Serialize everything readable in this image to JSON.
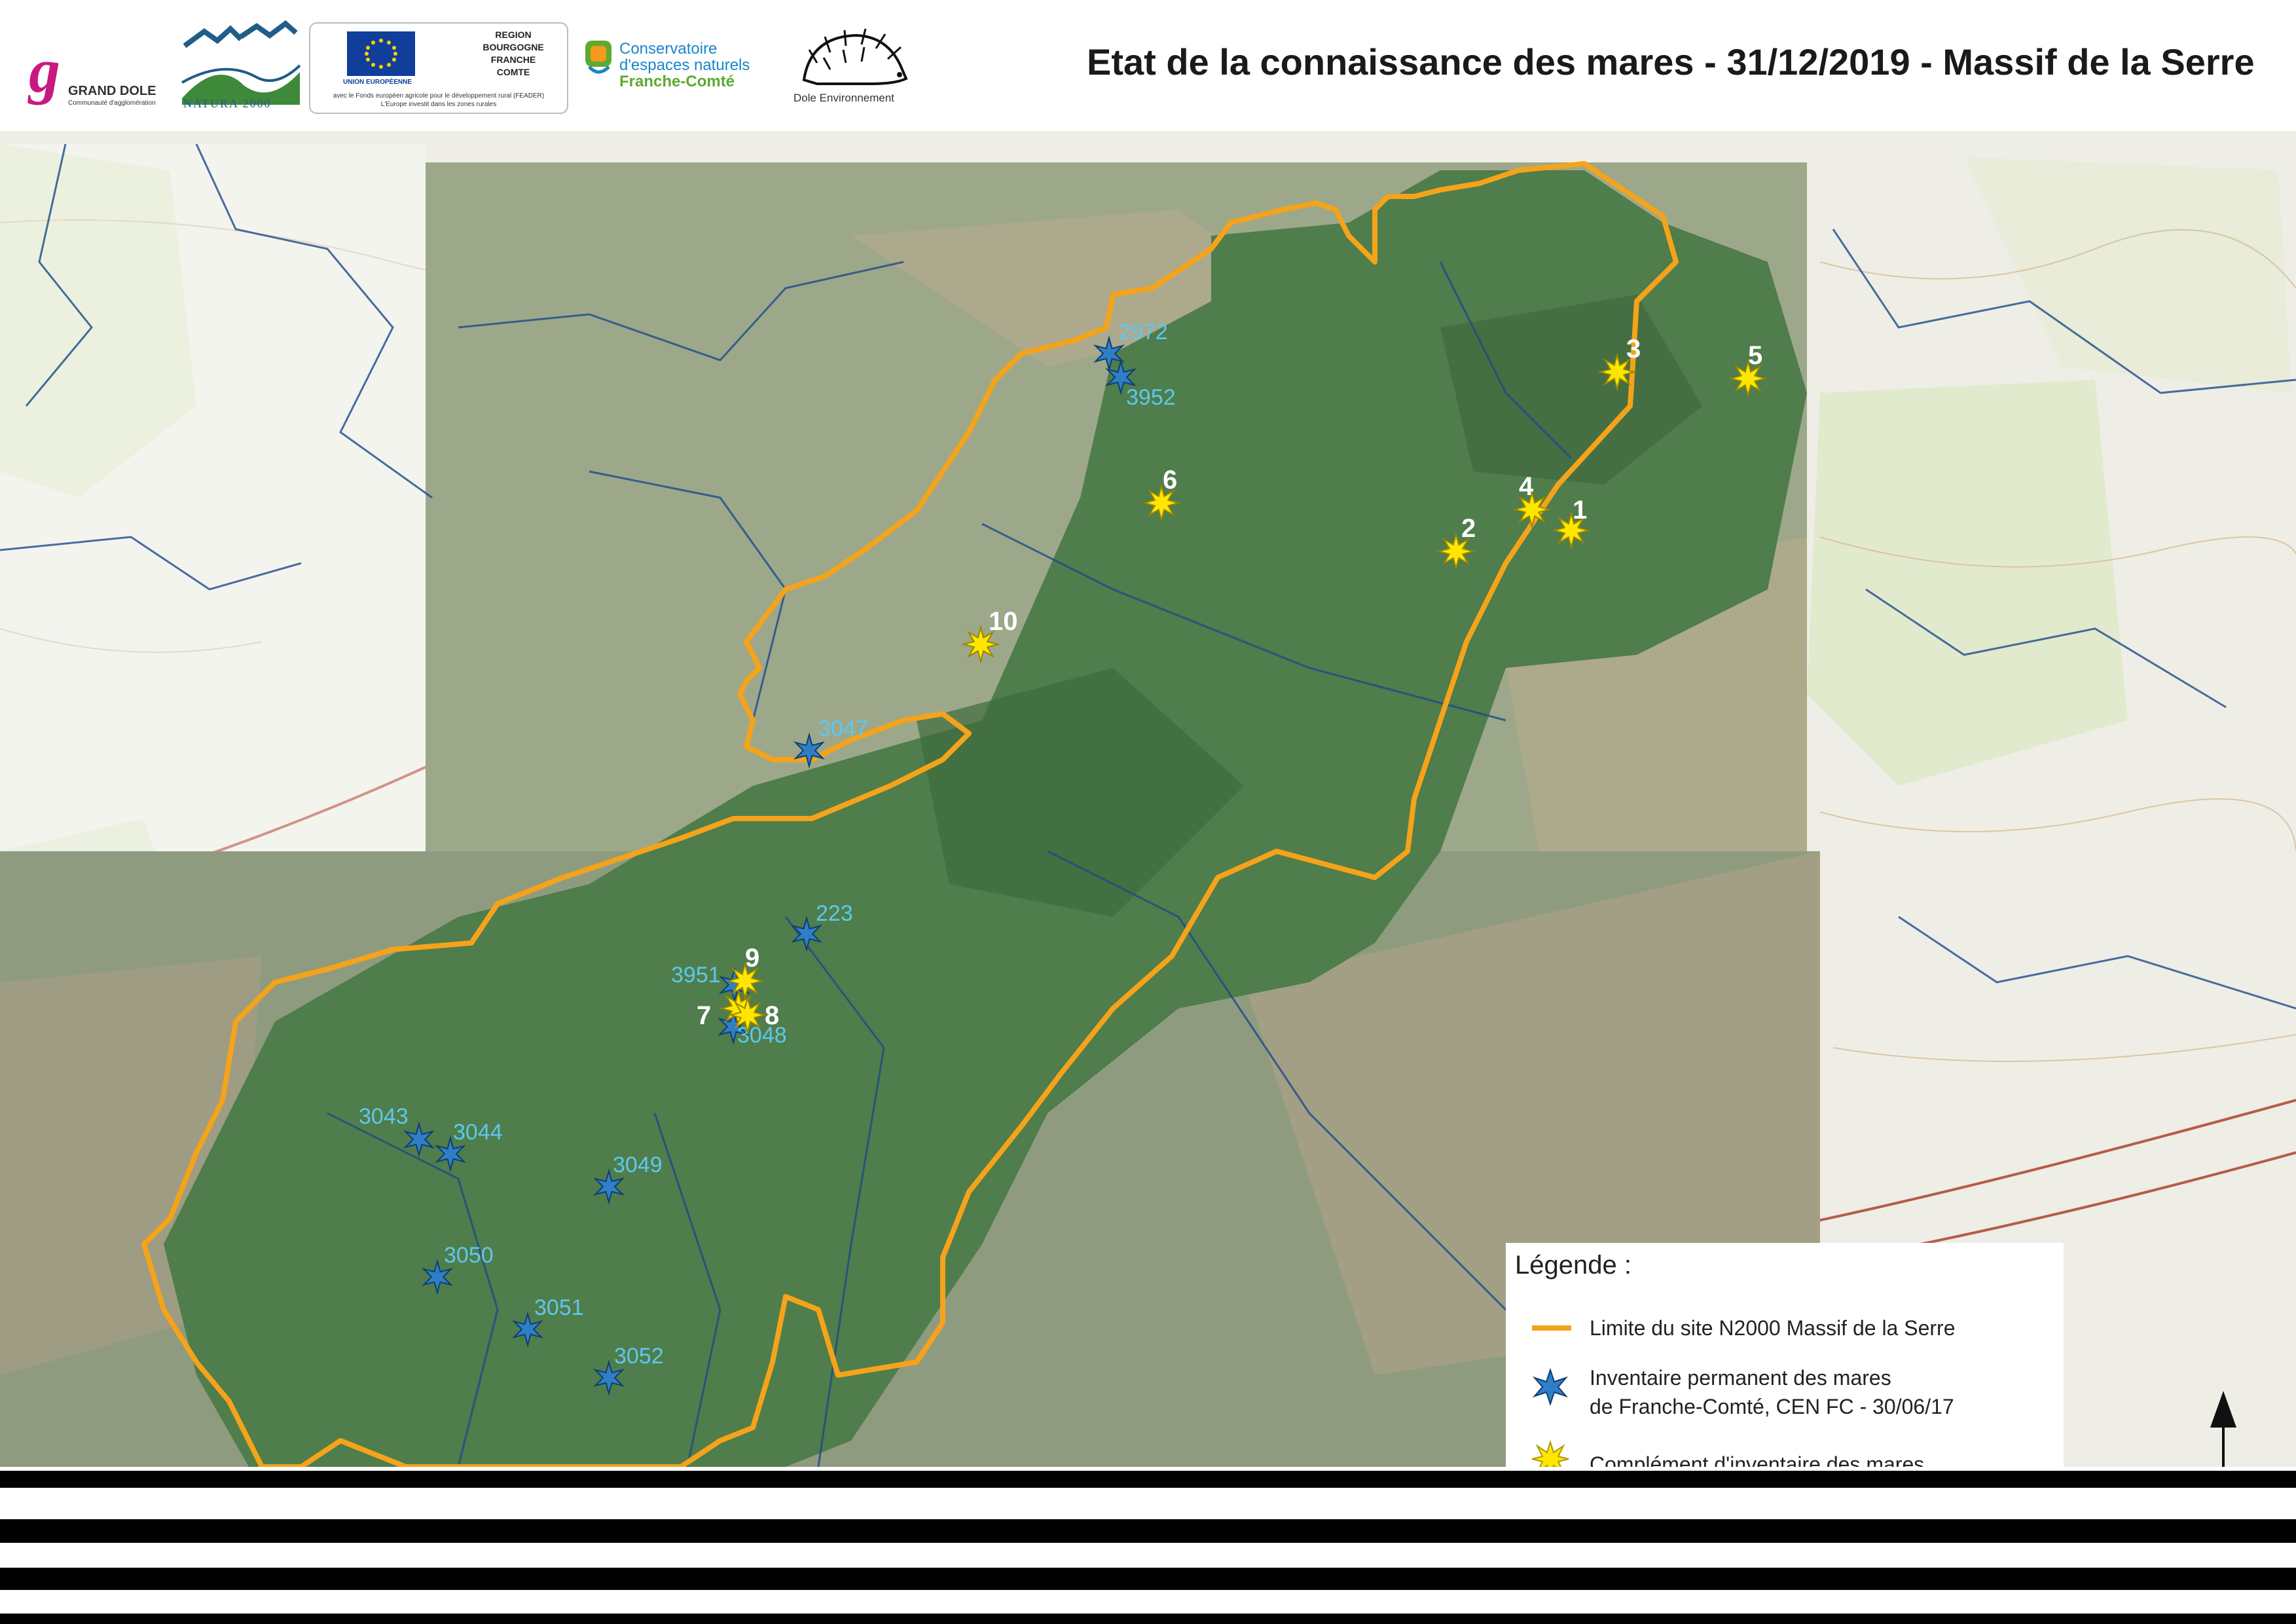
{
  "header": {
    "title": "Etat de la connaissance des mares - 31/12/2019 - Massif de la Serre",
    "logos": {
      "grand_dole_mark": "g",
      "grand_dole_name": "GRAND DOLE",
      "grand_dole_sub": "Communauté d'agglomération",
      "natura": "NATURA 2000",
      "eu_union": "UNION EUROPÉENNE",
      "region_line1": "REGION",
      "region_line2": "BOURGOGNE",
      "region_line3": "FRANCHE",
      "region_line4": "COMTE",
      "feader_line1": "avec le Fonds européen agricole pour le développement rural (FEADER)",
      "feader_line2": "L'Europe investit dans les zones rurales",
      "cen_line1": "Conservatoire",
      "cen_line2": "d'espaces naturels",
      "cen_line3": "Franche-Comté",
      "dole_env": "Dole Environnement"
    }
  },
  "map": {
    "colors": {
      "boundary": "#f5a31a",
      "forest": "#4f7d4b",
      "permanent_marker": "#2f7fc8",
      "complement_marker": "#ffe600",
      "permanent_label": "#5ec8ee"
    },
    "permanent_ponds": [
      "2972",
      "3952",
      "3047",
      "223",
      "3951",
      "3048",
      "3043",
      "3044",
      "3049",
      "3050",
      "3051",
      "3052"
    ],
    "complement_ponds": [
      "1",
      "2",
      "3",
      "4",
      "5",
      "6",
      "7",
      "8",
      "9",
      "10"
    ]
  },
  "legend": {
    "title": "Légende :",
    "boundary_label": "Limite du site N2000 Massif de la Serre",
    "permanent_line1": "Inventaire permanent des mares",
    "permanent_line2": "de Franche-Comté, CEN FC - 30/06/17",
    "complement_line1": "Complément d'inventaire des mares"
  }
}
